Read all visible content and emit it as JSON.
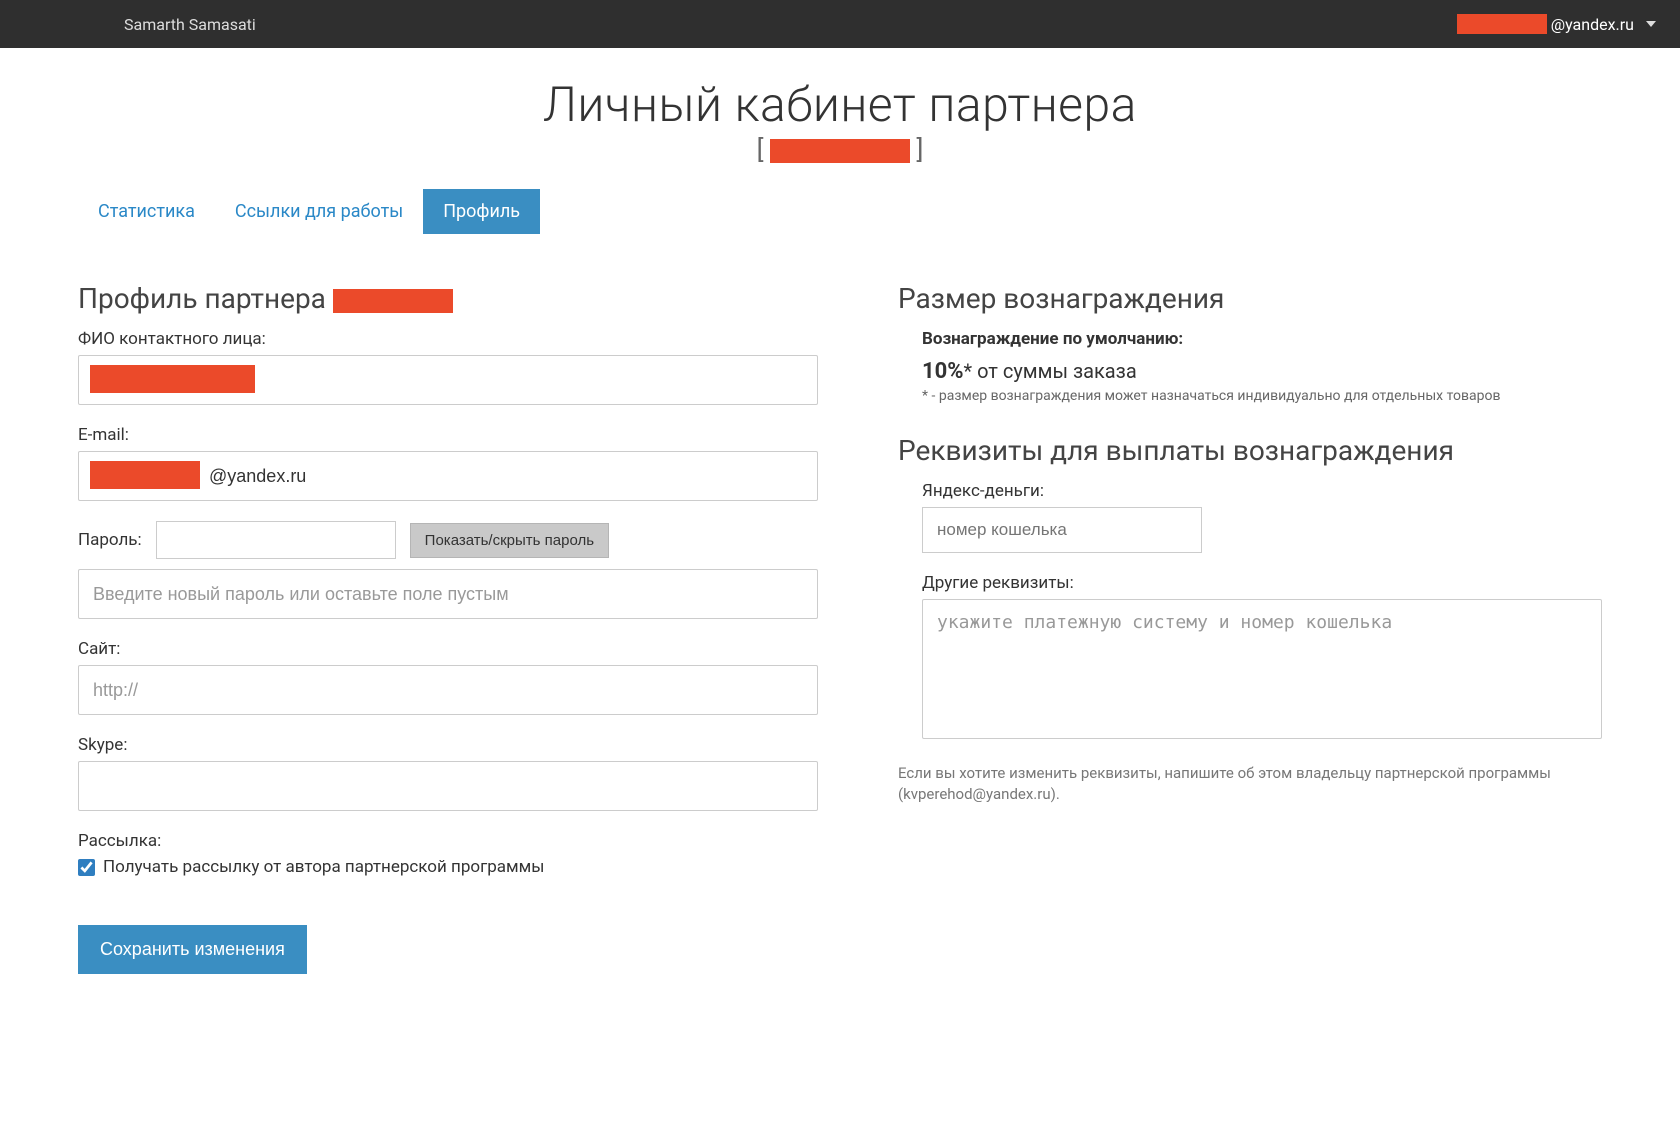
{
  "header": {
    "brand": "Samarth Samasati",
    "user_email_suffix": "@yandex.ru"
  },
  "page_title": "Личный кабинет партнера",
  "partner_id_brackets": {
    "open": "[ ",
    "close": " ]"
  },
  "tabs": [
    {
      "label": "Статистика",
      "active": false
    },
    {
      "label": "Ссылки для работы",
      "active": false
    },
    {
      "label": "Профиль",
      "active": true
    }
  ],
  "profile": {
    "section_title_prefix": "Профиль партнера ",
    "fio_label": "ФИО контактного лица:",
    "email_label": "E-mail:",
    "email_value_suffix": "@yandex.ru",
    "password_label": "Пароль:",
    "toggle_password_btn": "Показать/скрыть пароль",
    "new_password_placeholder": "Введите новый пароль или оставьте поле пустым",
    "site_label": "Сайт:",
    "site_placeholder": "http://",
    "skype_label": "Skype:",
    "mailing_label": "Рассылка:",
    "mailing_checkbox_label": "Получать рассылку от автора партнерской программы",
    "mailing_checked": true,
    "save_btn": "Сохранить изменения"
  },
  "reward": {
    "section_title": "Размер вознаграждения",
    "default_label": "Вознаграждение по умолчанию:",
    "percent": "10%",
    "of_order_text": "* от суммы заказа",
    "note": "* - размер вознаграждения может назначаться индивидуально для отдельных товаров"
  },
  "payout": {
    "section_title": "Реквизиты для выплаты вознаграждения",
    "yandex_money_label": "Яндекс-деньги:",
    "yandex_money_placeholder": "номер кошелька",
    "other_label": "Другие реквизиты:",
    "other_placeholder": "укажите платежную систему и номер кошелька",
    "footer_note": "Если вы хотите изменить реквизиты, напишите об этом владельцу партнерской программы (kvperehod@yandex.ru)."
  }
}
